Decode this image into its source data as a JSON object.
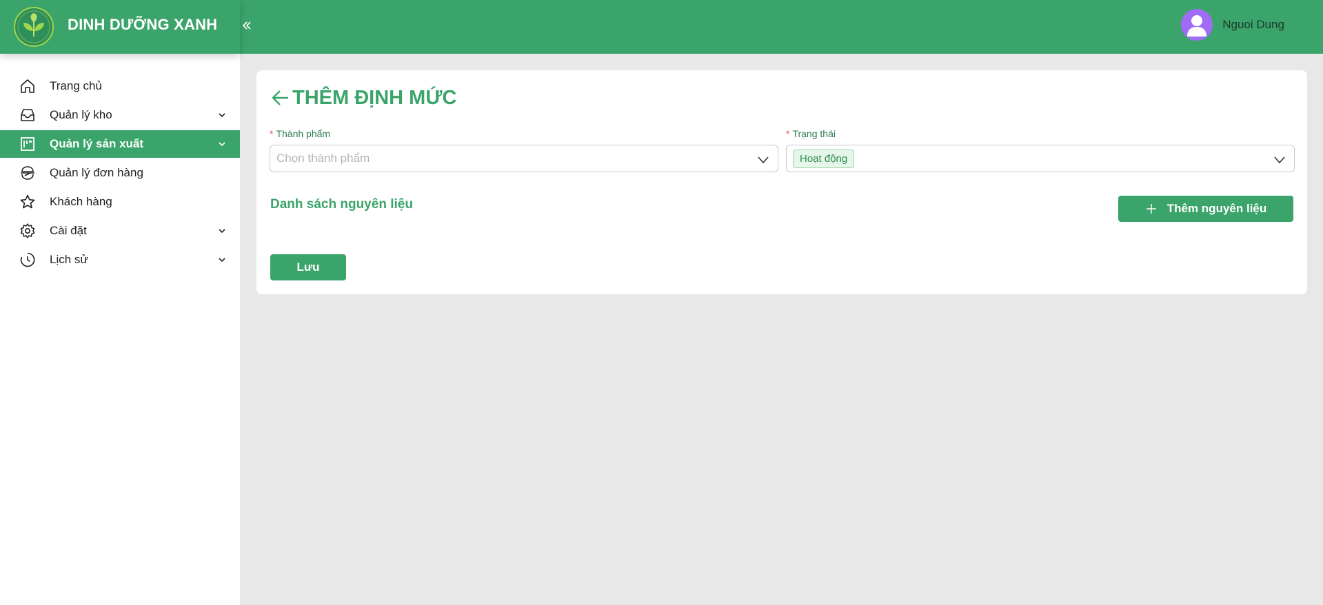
{
  "brand": {
    "name": "DINH DƯỠNG XANH",
    "logo_icon": "leaf-logo-icon"
  },
  "header": {
    "user_name": "Nguoi Dung",
    "avatar_color": "#a06bf5"
  },
  "sidebar": {
    "items": [
      {
        "label": "Trang chủ",
        "icon": "home-icon",
        "has_chevron": false,
        "active": false
      },
      {
        "label": "Quản lý kho",
        "icon": "inbox-icon",
        "has_chevron": true,
        "active": false
      },
      {
        "label": "Quản lý sản xuất",
        "icon": "production-icon",
        "has_chevron": true,
        "active": true
      },
      {
        "label": "Quản lý đơn hàng",
        "icon": "order-icon",
        "has_chevron": false,
        "active": false
      },
      {
        "label": "Khách hàng",
        "icon": "star-icon",
        "has_chevron": false,
        "active": false
      },
      {
        "label": "Cài đặt",
        "icon": "gear-icon",
        "has_chevron": true,
        "active": false
      },
      {
        "label": "Lịch sử",
        "icon": "clock-icon",
        "has_chevron": true,
        "active": false
      }
    ]
  },
  "form": {
    "title": "THÊM ĐỊNH MỨC",
    "required_mark": "*",
    "product_label": "Thành phẩm",
    "product_placeholder": "Chọn thành phẩm",
    "status_label": "Trạng thái",
    "status_value": "Hoạt động",
    "materials_title": "Danh sách nguyên liệu",
    "add_material_label": "Thêm nguyên liệu",
    "save_label": "Lưu"
  },
  "colors": {
    "brand_green": "#3aa46a",
    "background": "#e8e8e8",
    "required_red": "#e74c4c"
  }
}
